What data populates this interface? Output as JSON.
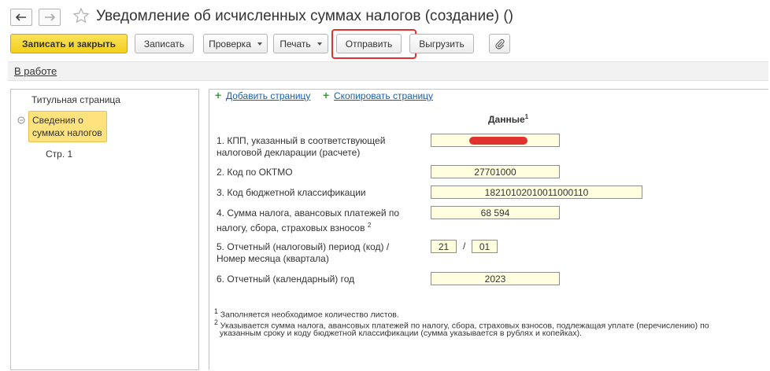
{
  "window": {
    "title": "Уведомление об исчисленных суммах налогов (создание) ()"
  },
  "toolbar": {
    "save_close": "Записать и закрыть",
    "save": "Записать",
    "check": "Проверка",
    "print": "Печать",
    "send": "Отправить",
    "export": "Выгрузить"
  },
  "status": {
    "label": "В работе"
  },
  "tree": {
    "title_page": "Титульная страница",
    "section": "Сведения о суммах налогов",
    "page": "Стр. 1"
  },
  "actions": {
    "add_page": "Добавить страницу",
    "copy_page": "Скопировать страницу"
  },
  "form": {
    "column_header": "Данные",
    "fields": [
      {
        "label_line1": "1. КПП, указанный в соответствующей",
        "label_line2": "налоговой декларации (расчете)",
        "value": ""
      },
      {
        "label_line1": "2. Код по ОКТМО",
        "value": "27701000"
      },
      {
        "label_line1": "3. Код бюджетной классификации",
        "value": "18210102010011000110"
      },
      {
        "label_line1": "4. Сумма налога, авансовых платежей по",
        "label_line2": "налогу, сбора, страховых взносов",
        "value": "68 594"
      },
      {
        "label_line1": "5. Отчетный (налоговый) период (код) /",
        "label_line2": "Номер месяца (квартала)",
        "value_a": "21",
        "value_b": "01"
      },
      {
        "label_line1": "6. Отчетный (календарный) год",
        "value": "2023"
      }
    ]
  },
  "footnotes": {
    "note1": "Заполняется необходимое количество листов.",
    "note2_line1": "Указывается сумма налога, авансовых платежей по налогу, сбора, страховых взносов, подлежащая уплате (перечислению) по",
    "note2_line2": "указанным сроку и коду бюджетной классификации (сумма указывается в рублях и копейках)."
  },
  "icons": {
    "back": "arrow-left-icon",
    "forward": "arrow-right-icon",
    "favorite": "star-icon",
    "attach": "paperclip-icon",
    "collapse": "collapse-icon",
    "add": "plus-icon"
  },
  "colors": {
    "primary_button": "#f3cf1d",
    "highlight_border": "#e0322e",
    "selected_item": "#fde27e",
    "field_bg": "#ffffe0",
    "link": "#1a5fa8",
    "plus": "#3aa235"
  }
}
